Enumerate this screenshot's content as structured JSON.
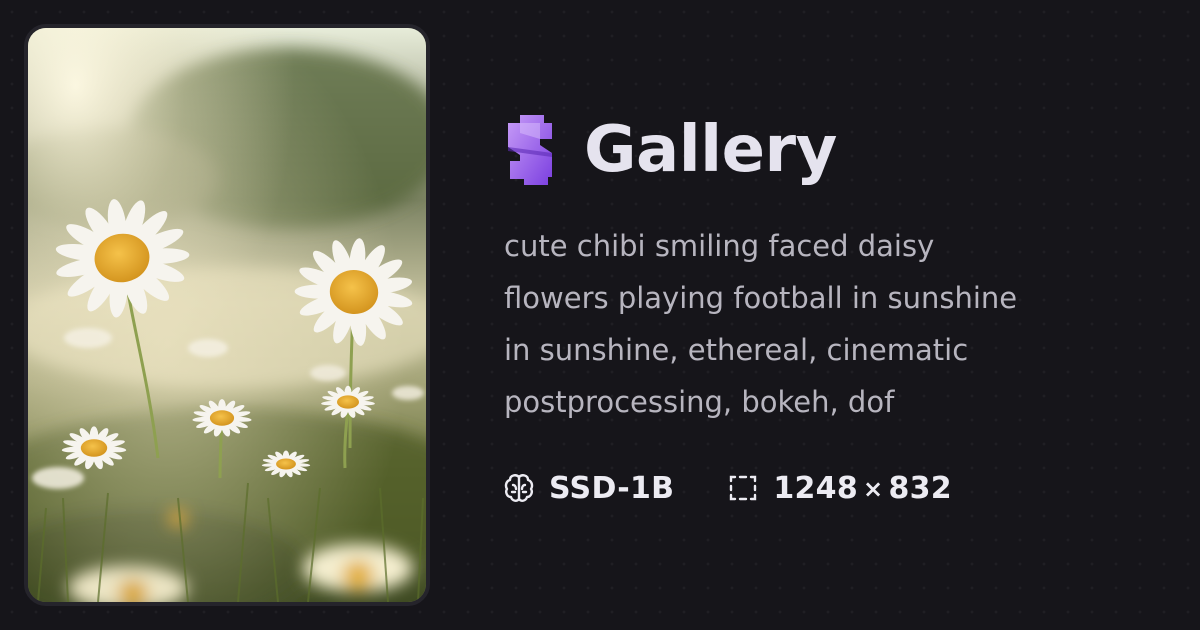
{
  "image": {
    "alt": "",
    "subject": "daisy-meadow-photo"
  },
  "header": {
    "logo_icon": "puzzle-s-icon",
    "title": "Gallery"
  },
  "prompt": {
    "text": "cute chibi smiling faced daisy flowers playing football in sunshine in sunshine, ethereal, cinematic postprocessing, bokeh, dof"
  },
  "meta": {
    "model": {
      "icon": "brain-icon",
      "label": "SSD-1B"
    },
    "dimensions": {
      "icon": "dashed-frame-icon",
      "width": "1248",
      "times": "×",
      "height": "832"
    }
  },
  "colors": {
    "background": "#16151a",
    "accent": "#9b63f0",
    "title": "#e5e3ee",
    "prompt": "#b7b5bf"
  }
}
